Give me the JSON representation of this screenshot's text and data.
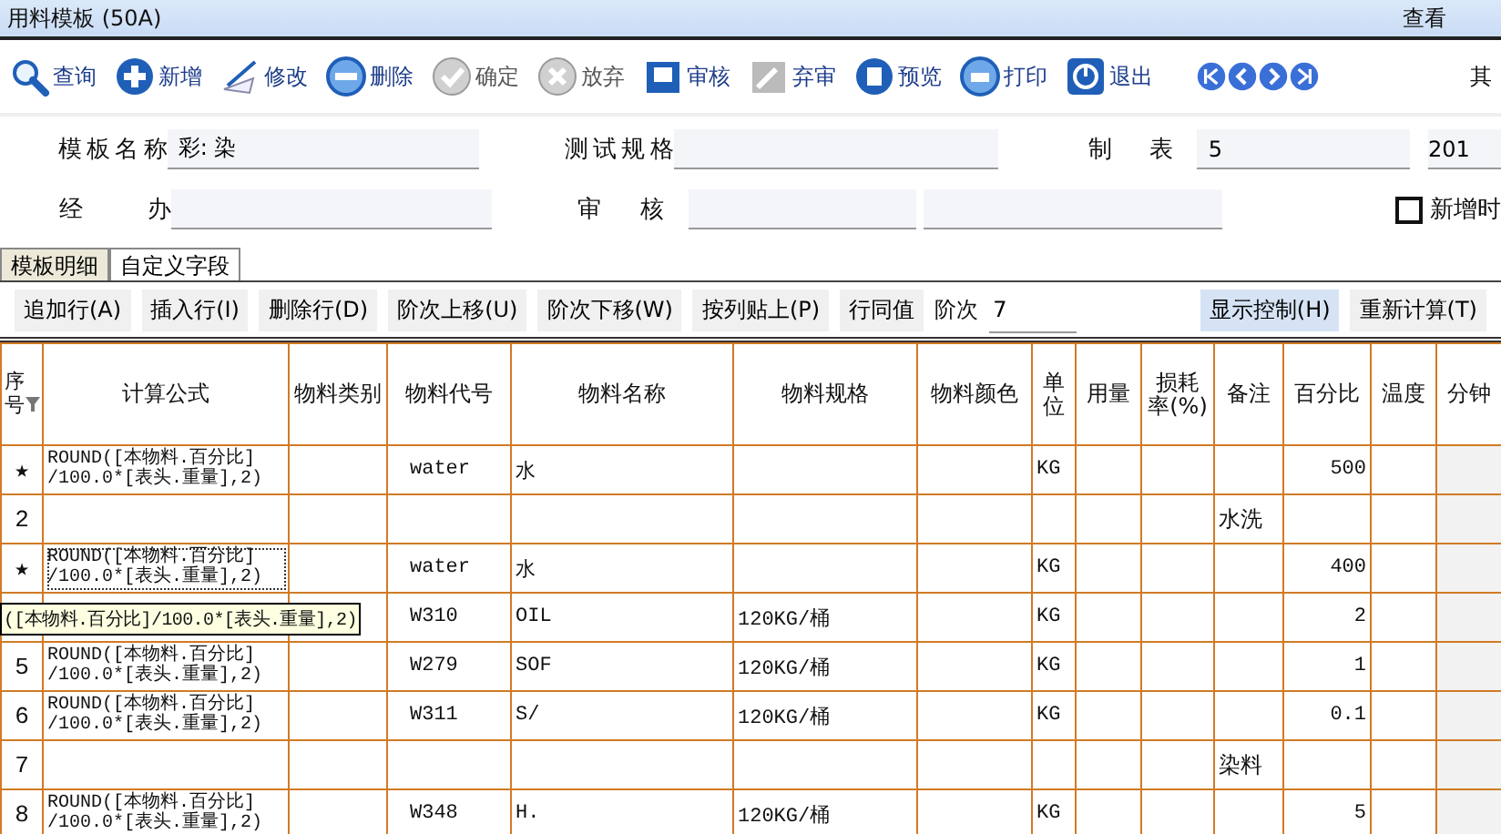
{
  "window": {
    "title": "用料模板 (50A)",
    "menu": "查看"
  },
  "toolbar": [
    {
      "label": "查询",
      "disabled": false
    },
    {
      "label": "新增",
      "disabled": false
    },
    {
      "label": "修改",
      "disabled": false
    },
    {
      "label": "删除",
      "disabled": false
    },
    {
      "label": "确定",
      "disabled": true
    },
    {
      "label": "放弃",
      "disabled": true
    },
    {
      "label": "审核",
      "disabled": false
    },
    {
      "label": "弃审",
      "disabled": false
    },
    {
      "label": "预览",
      "disabled": false
    },
    {
      "label": "打印",
      "disabled": false
    },
    {
      "label": "退出",
      "disabled": false
    }
  ],
  "toolbar_more": "其",
  "form": {
    "template_name": {
      "label": "模板名称",
      "value": "彩: 染"
    },
    "test_spec": {
      "label": "测试规格"
    },
    "maker": {
      "label": "制 表",
      "value": "5"
    },
    "date": {
      "value": "201"
    },
    "handler": {
      "label": "经 办"
    },
    "reviewer": {
      "label": "审 核"
    },
    "add_option": {
      "label": "新增时",
      "checked": false
    }
  },
  "tabs": [
    {
      "label": "模板明细",
      "selected": true
    },
    {
      "label": "自定义字段",
      "selected": false
    }
  ],
  "actions": [
    {
      "label": "追加行(A)",
      "highlighted": false
    },
    {
      "label": "插入行(I)",
      "highlighted": false
    },
    {
      "label": "删除行(D)",
      "highlighted": false
    },
    {
      "label": "阶次上移(U)",
      "highlighted": false
    },
    {
      "label": "阶次下移(W)",
      "highlighted": false
    },
    {
      "label": "按列贴上(P)",
      "highlighted": false
    },
    {
      "label": "行同值",
      "highlighted": false
    }
  ],
  "level_field": {
    "label": "阶次",
    "value": "7"
  },
  "right_actions": [
    {
      "label": "显示控制(H)",
      "highlighted": true
    },
    {
      "label": "重新计算(T)",
      "highlighted": false
    }
  ],
  "table": {
    "columns": [
      "序号",
      "计算公式",
      "物料类别",
      "物料代号",
      "物料名称",
      "物料规格",
      "物料颜色",
      "单位",
      "用量",
      "损耗率(%)",
      "备注",
      "百分比",
      "温度",
      "分钟"
    ],
    "rows": [
      {
        "index": "★",
        "formula": "ROUND([本物料.百分比]\n/100.0*[表头.重量],2)",
        "code": "water",
        "name": "水",
        "unit": "KG",
        "percent": "500",
        "focused": false
      },
      {
        "index": "2",
        "note": "水洗",
        "focused": false
      },
      {
        "index": "★",
        "formula": "ROUND([本物料.百分比]\n/100.0*[表头.重量],2)",
        "code": "water",
        "name": "水",
        "unit": "KG",
        "percent": "400",
        "focused": true
      },
      {
        "code": "W310",
        "name": "OIL",
        "spec": "120KG/桶",
        "unit": "KG",
        "percent": "2",
        "focused": false
      },
      {
        "index": "5",
        "formula": "ROUND([本物料.百分比]\n/100.0*[表头.重量],2)",
        "code": "W279",
        "name": "SOF",
        "spec": "120KG/桶",
        "unit": "KG",
        "percent": "1",
        "focused": false
      },
      {
        "index": "6",
        "formula": "ROUND([本物料.百分比]\n/100.0*[表头.重量],2)",
        "code": "W311",
        "name": "S/",
        "spec": "120KG/桶",
        "unit": "KG",
        "percent": "0.1",
        "focused": false
      },
      {
        "index": "7",
        "note": "染料",
        "focused": false
      },
      {
        "index": "8",
        "formula": "ROUND([本物料.百分比]\n/100.0*[表头.重量],2)",
        "code": "W348",
        "name": "H.",
        "spec": "120KG/桶",
        "unit": "KG",
        "percent": "5",
        "focused": false
      }
    ],
    "tooltip": "([本物料.百分比]/100.0*[表头.重量],2)"
  }
}
